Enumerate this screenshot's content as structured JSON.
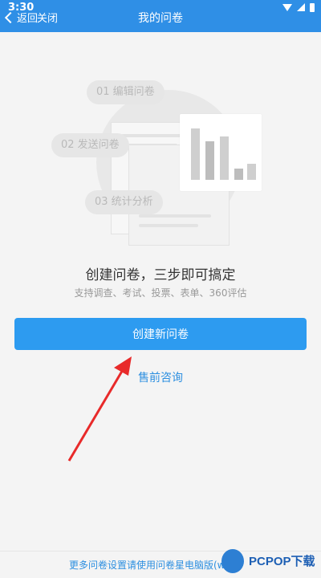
{
  "status_bar": {
    "time": "3:30"
  },
  "nav": {
    "back_label": "返回",
    "close_label": "关闭",
    "title": "我的问卷"
  },
  "illustration": {
    "steps": [
      "01 编辑问卷",
      "02 发送问卷",
      "03 统计分析"
    ]
  },
  "main": {
    "headline": "创建问卷，三步即可搞定",
    "subline": "支持调查、考试、投票、表单、360评估",
    "create_button": "创建新问卷",
    "consult_link": "售前咨询"
  },
  "footer": {
    "note": "更多问卷设置请使用问卷星电脑版(www"
  },
  "watermark": {
    "text": "PCPOP下载"
  },
  "colors": {
    "header_blue": "#2f8fe6",
    "button_blue": "#2d9bf0",
    "link_blue": "#2d8fe0",
    "annotation_red": "#e82a2a"
  },
  "icons": [
    "wifi-icon",
    "cell-signal-icon",
    "battery-icon",
    "chevron-left-icon"
  ]
}
